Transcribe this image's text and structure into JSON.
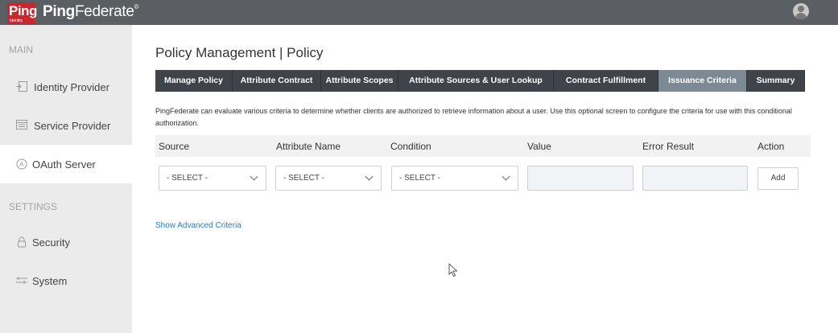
{
  "topbar": {
    "logo_text": "Ping",
    "logo_subtext": "Identity",
    "product_bold": "Ping",
    "product_light": "Federate",
    "product_mark": "®",
    "avatar_icon": "user-avatar-icon"
  },
  "sidebar": {
    "main_label": "MAIN",
    "settings_label": "SETTINGS",
    "items": [
      {
        "label": "Identity Provider",
        "icon": "identity-provider-icon"
      },
      {
        "label": "Service Provider",
        "icon": "service-provider-icon"
      },
      {
        "label": "OAuth Server",
        "icon": "oauth-server-icon"
      },
      {
        "label": "Security",
        "icon": "lock-icon"
      },
      {
        "label": "System",
        "icon": "system-icon"
      }
    ]
  },
  "page": {
    "title": "Policy Management | Policy",
    "tabs": [
      {
        "label": "Manage Policy"
      },
      {
        "label": "Attribute Contract"
      },
      {
        "label": "Attribute Scopes"
      },
      {
        "label": "Attribute Sources & User Lookup"
      },
      {
        "label": "Contract Fulfillment"
      },
      {
        "label": "Issuance Criteria"
      },
      {
        "label": "Summary"
      }
    ],
    "active_tab": "Issuance Criteria",
    "description": "PingFederate can evaluate various criteria to determine whether clients are authorized to retrieve information about a user. Use this optional screen to configure the criteria for use with this conditional authorization."
  },
  "criteria": {
    "columns": [
      "Source",
      "Attribute Name",
      "Condition",
      "Value",
      "Error Result",
      "Action"
    ],
    "source_select": "- SELECT -",
    "attribute_select": "- SELECT -",
    "condition_select": "- SELECT -",
    "value": "",
    "error_result": "",
    "add_label": "Add"
  },
  "advanced_link": "Show Advanced Criteria"
}
